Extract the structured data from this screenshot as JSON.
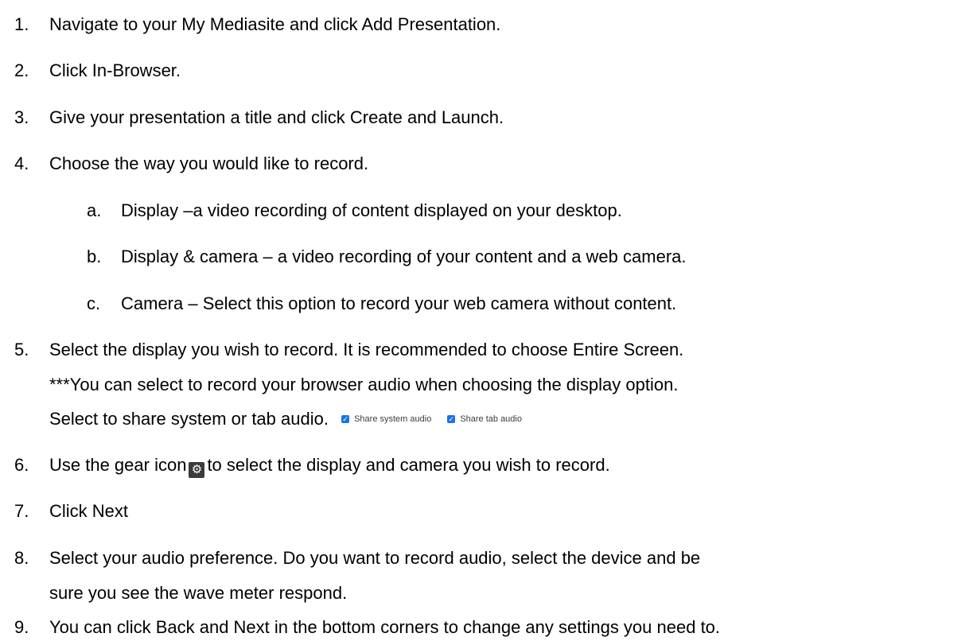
{
  "steps": [
    {
      "num": "1.",
      "text": "Navigate to your My Mediasite and click Add Presentation."
    },
    {
      "num": "2.",
      "text": "Click In-Browser."
    },
    {
      "num": "3.",
      "text": "Give your presentation a title and click Create and Launch."
    },
    {
      "num": "4.",
      "text": "Choose the way you would like to record."
    }
  ],
  "sub_steps": [
    {
      "num": "a.",
      "text": "Display –a video recording of content displayed on your desktop."
    },
    {
      "num": "b.",
      "text": "Display & camera – a video recording of your content and a web camera."
    },
    {
      "num": "c.",
      "text": "Camera – Select this option to record your web camera without content."
    }
  ],
  "step5": {
    "num": "5.",
    "text": "Select the display you wish to record.  It is recommended to choose Entire Screen.",
    "note": "***You can select to record your browser audio when choosing the display option.",
    "share_text": "Select to share system or tab audio.",
    "checkbox_system": "Share system audio",
    "checkbox_tab": "Share tab audio"
  },
  "step6": {
    "num": "6.",
    "before": "Use the gear icon",
    "after": "to select the display and camera you wish to record."
  },
  "step7": {
    "num": "7.",
    "text": " Click Next"
  },
  "step8": {
    "num": "8.",
    "text": "Select your audio preference.  Do you want to record audio, select the device and be",
    "text2": "sure you see the wave meter respond."
  },
  "step9": {
    "num": "9.",
    "text": "You can click Back and Next in the bottom corners to change any settings you need to."
  },
  "icons": {
    "checkbox": "checkbox-checked-icon",
    "gear": "gear-icon"
  },
  "colors": {
    "checkbox": "#1a73e8",
    "gear_bg": "#3b3b3b"
  }
}
